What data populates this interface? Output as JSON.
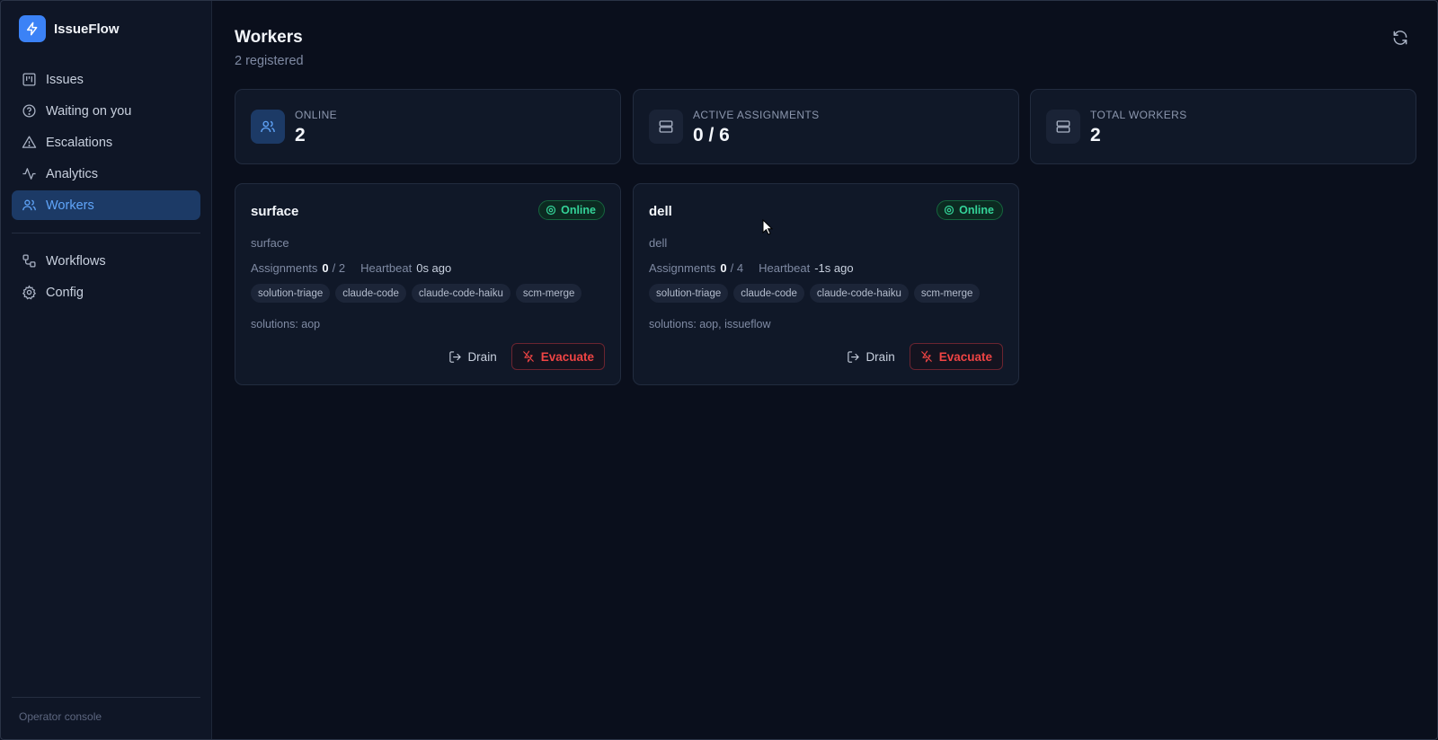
{
  "app": {
    "name": "IssueFlow",
    "brand_color": "#3b82f6"
  },
  "sidebar": {
    "items": [
      {
        "label": "Issues",
        "icon": "kanban-icon"
      },
      {
        "label": "Waiting on you",
        "icon": "help-circle-icon"
      },
      {
        "label": "Escalations",
        "icon": "warning-triangle-icon"
      },
      {
        "label": "Analytics",
        "icon": "activity-icon"
      },
      {
        "label": "Workers",
        "icon": "users-icon",
        "active": true
      }
    ],
    "secondary": [
      {
        "label": "Workflows",
        "icon": "workflow-icon"
      },
      {
        "label": "Config",
        "icon": "gear-icon"
      }
    ],
    "footer": "Operator console"
  },
  "page": {
    "title": "Workers",
    "subtitle": "2 registered"
  },
  "stats": [
    {
      "label": "ONLINE",
      "value": "2",
      "icon": "users-icon"
    },
    {
      "label": "ACTIVE ASSIGNMENTS",
      "value": "0 / 6",
      "icon": "server-icon"
    },
    {
      "label": "TOTAL WORKERS",
      "value": "2",
      "icon": "server-icon"
    }
  ],
  "workers": [
    {
      "name": "surface",
      "host": "surface",
      "status": "Online",
      "assignments_label": "Assignments",
      "assignments_active": "0",
      "assignments_total": "/ 2",
      "heartbeat_label": "Heartbeat",
      "heartbeat_value": "0s ago",
      "tags": [
        "solution-triage",
        "claude-code",
        "claude-code-haiku",
        "scm-merge"
      ],
      "solutions": "solutions: aop",
      "drain_label": "Drain",
      "evacuate_label": "Evacuate"
    },
    {
      "name": "dell",
      "host": "dell",
      "status": "Online",
      "assignments_label": "Assignments",
      "assignments_active": "0",
      "assignments_total": "/ 4",
      "heartbeat_label": "Heartbeat",
      "heartbeat_value": "-1s ago",
      "tags": [
        "solution-triage",
        "claude-code",
        "claude-code-haiku",
        "scm-merge"
      ],
      "solutions": "solutions: aop, issueflow",
      "drain_label": "Drain",
      "evacuate_label": "Evacuate"
    }
  ],
  "colors": {
    "online": "#34d399",
    "danger": "#ef4444",
    "accent": "#60a5fa"
  }
}
